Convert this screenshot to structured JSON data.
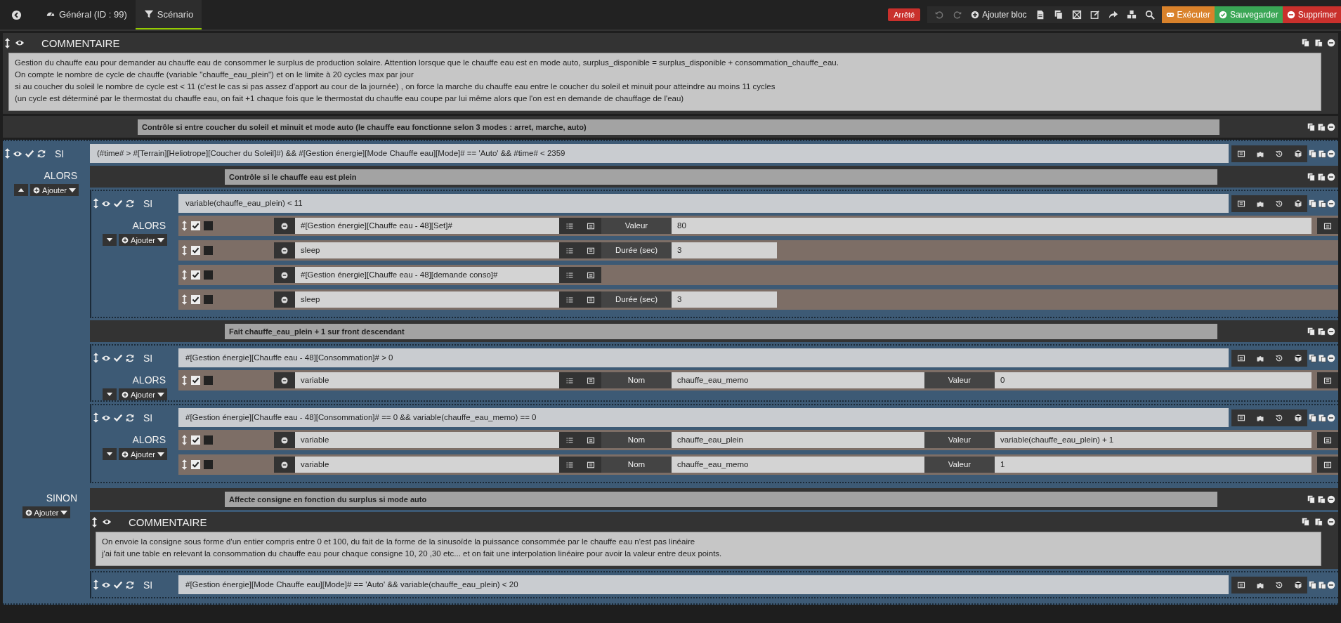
{
  "topbar": {
    "tabs": [
      {
        "label": "Général (ID : 99)",
        "selected": false,
        "kind": "general"
      },
      {
        "label": "Scénario",
        "selected": true,
        "kind": "scenario"
      }
    ],
    "status": "Arrêté",
    "add_block": "Ajouter bloc",
    "actions": [
      {
        "label": "Exécuter",
        "kind": "run"
      },
      {
        "label": "Sauvegarder",
        "kind": "save"
      },
      {
        "label": "Supprimer",
        "kind": "delete"
      }
    ]
  },
  "blocks": [
    {
      "kind": "comment",
      "title": "COMMENTAIRE",
      "text": "Gestion du chauffe eau pour demander au chauffe eau de consommer le surplus de production solaire. Attention lorsque que le chauffe eau est en mode auto, surplus_disponible = surplus_disponible + consommation_chauffe_eau.\nOn compte le nombre de cycle de chauffe (variable \"chauffe_eau_plein\") et on le limite à 20 cycles max par jour\nsi au coucher du soleil le nombre de cycle est < 11 (c'est le cas si pas assez d'apport au cour de la journée) , on force la marche du chauffe eau entre le coucher du soleil et minuit pour atteindre au moins 11 cycles\n(un cycle est déterminé par le thermostat du chauffe eau, on fait +1 chaque fois que le thermostat du chauffe eau coupe par lui même alors que l'on est en demande de chauffage de l'eau)"
    },
    {
      "kind": "label",
      "text": "Contrôle si entre coucher du soleil et minuit et mode auto (le chauffe eau fonctionne selon 3 modes : arret, marche, auto)"
    },
    {
      "kind": "if",
      "keyword": "SI",
      "enabled": true,
      "condition": "(#time# > #[Terrain][Heliotrope][Coucher du Soleil]#) && #[Gestion énergie][Mode Chauffe eau][Mode]# == 'Auto'  && #time# < 2359",
      "then": {
        "label": "ALORS",
        "collapsed": false,
        "add": "Ajouter",
        "children": [
          {
            "kind": "label",
            "text": "Contrôle si le chauffe eau est plein"
          },
          {
            "kind": "if",
            "keyword": "SI",
            "enabled": true,
            "condition": "variable(chauffe_eau_plein) < 11",
            "then": {
              "label": "ALORS",
              "collapsed": true,
              "add": "Ajouter",
              "children": [
                {
                  "kind": "set",
                  "enabled": true,
                  "parallel": false,
                  "command": "#[Gestion énergie][Chauffe eau - 48][Set]#",
                  "fields": [
                    {
                      "label": "Valeur",
                      "value": "80"
                    }
                  ]
                },
                {
                  "kind": "sleep",
                  "enabled": true,
                  "parallel": false,
                  "command": "sleep",
                  "fields": [
                    {
                      "label": "Durée (sec)",
                      "value": "3"
                    }
                  ]
                },
                {
                  "kind": "event",
                  "enabled": true,
                  "parallel": false,
                  "command": "#[Gestion énergie][Chauffe eau - 48][demande conso]#"
                },
                {
                  "kind": "sleep",
                  "enabled": true,
                  "parallel": false,
                  "command": "sleep",
                  "fields": [
                    {
                      "label": "Durée (sec)",
                      "value": "3"
                    }
                  ]
                }
              ]
            }
          },
          {
            "kind": "label",
            "text": "Fait chauffe_eau_plein + 1 sur front descendant"
          },
          {
            "kind": "if",
            "keyword": "SI",
            "enabled": true,
            "condition": "#[Gestion énergie][Chauffe eau - 48][Consommation]# > 0",
            "then": {
              "label": "ALORS",
              "collapsed": true,
              "add": "Ajouter",
              "children": [
                {
                  "kind": "variable",
                  "enabled": true,
                  "parallel": false,
                  "command": "variable",
                  "fields": [
                    {
                      "label": "Nom",
                      "value": "chauffe_eau_memo"
                    },
                    {
                      "label": "Valeur",
                      "value": "0"
                    }
                  ]
                }
              ]
            }
          },
          {
            "kind": "if",
            "keyword": "SI",
            "enabled": true,
            "condition": "#[Gestion énergie][Chauffe eau - 48][Consommation]# == 0  && variable(chauffe_eau_memo) == 0",
            "then": {
              "label": "ALORS",
              "collapsed": true,
              "add": "Ajouter",
              "children": [
                {
                  "kind": "variable",
                  "enabled": true,
                  "parallel": false,
                  "command": "variable",
                  "fields": [
                    {
                      "label": "Nom",
                      "value": "chauffe_eau_plein"
                    },
                    {
                      "label": "Valeur",
                      "value": "variable(chauffe_eau_plein) + 1"
                    }
                  ]
                },
                {
                  "kind": "variable",
                  "enabled": true,
                  "parallel": false,
                  "command": "variable",
                  "fields": [
                    {
                      "label": "Nom",
                      "value": "chauffe_eau_memo"
                    },
                    {
                      "label": "Valeur",
                      "value": "1"
                    }
                  ]
                }
              ]
            }
          }
        ]
      },
      "else": {
        "label": "SINON",
        "add": "Ajouter",
        "children": [
          {
            "kind": "label",
            "text": "Affecte consigne en fonction du surplus si mode auto"
          },
          {
            "kind": "comment",
            "title": "COMMENTAIRE",
            "text": "On envoie la consigne sous forme d'un entier compris entre 0 et 100, du fait de la forme de la sinusoïde la puissance consommée par le chauffe eau n'est pas linéaire\nj'ai fait une table en relevant la consommation du chauffe eau pour chaque consigne 10, 20 ,30 etc... et on fait une interpolation linéaire pour avoir la valeur entre deux points."
          },
          {
            "kind": "if",
            "keyword": "SI",
            "enabled": true,
            "condition": "#[Gestion énergie][Mode Chauffe eau][Mode]# == 'Auto' && variable(chauffe_eau_plein) < 20"
          }
        ]
      }
    }
  ]
}
